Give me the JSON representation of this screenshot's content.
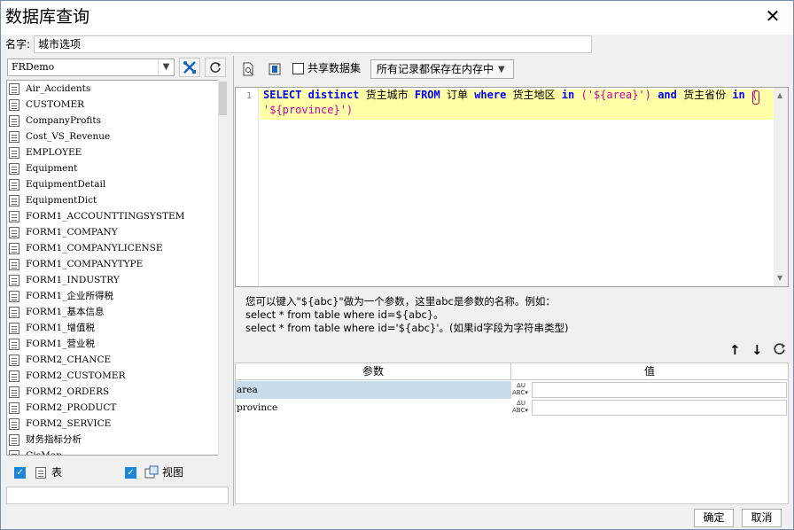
{
  "window": {
    "title": "数据库查询"
  },
  "name": {
    "label": "名字:",
    "value": "城市选项"
  },
  "datasource": {
    "selected": "FRDemo"
  },
  "tables": [
    "Air_Accidents",
    "CUSTOMER",
    "CompanyProfits",
    "Cost_VS_Revenue",
    "EMPLOYEE",
    "Equipment",
    "EquipmentDetail",
    "EquipmentDict",
    "FORM1_ACCOUNTTINGSYSTEM",
    "FORM1_COMPANY",
    "FORM1_COMPANYLICENSE",
    "FORM1_COMPANYTYPE",
    "FORM1_INDUSTRY",
    "FORM1_企业所得税",
    "FORM1_基本信息",
    "FORM1_增值税",
    "FORM1_营业税",
    "FORM2_CHANCE",
    "FORM2_CUSTOMER",
    "FORM2_ORDERS",
    "FORM2_PRODUCT",
    "FORM2_SERVICE",
    "财务指标分析",
    "GisMap"
  ],
  "filters": {
    "table_label": "表",
    "view_label": "视图"
  },
  "toolbar": {
    "share_label": "共享数据集",
    "storage_option": "所有记录都保存在内存中"
  },
  "editor": {
    "line_number": "1",
    "line1": [
      {
        "t": "SELECT",
        "c": "kw"
      },
      {
        "t": " ",
        "c": "sy"
      },
      {
        "t": "distinct",
        "c": "kw"
      },
      {
        "t": " 货主城市 ",
        "c": "sy"
      },
      {
        "t": "FROM",
        "c": "kw"
      },
      {
        "t": " 订单 ",
        "c": "sy"
      },
      {
        "t": "where",
        "c": "kw"
      },
      {
        "t": " 货主地区 ",
        "c": "sy"
      },
      {
        "t": "in",
        "c": "kw"
      },
      {
        "t": " (",
        "c": "str"
      },
      {
        "t": "'${area}'",
        "c": "str"
      },
      {
        "t": ")",
        "c": "str"
      },
      {
        "t": " ",
        "c": "sy"
      },
      {
        "t": "and",
        "c": "kw"
      },
      {
        "t": " 货主省份 ",
        "c": "sy"
      },
      {
        "t": "in",
        "c": "kw"
      },
      {
        "t": " (",
        "c": "str"
      }
    ],
    "line2": [
      {
        "t": "'${province}'",
        "c": "str"
      },
      {
        "t": ")",
        "c": "str"
      }
    ]
  },
  "help": {
    "line1": "您可以键入\"${abc}\"做为一个参数，这里abc是参数的名称。例如：",
    "line2": "select * from table where id=${abc}。",
    "line3": "select * from table where id='${abc}'。(如果id字段为字符串类型)"
  },
  "params": {
    "col_param": "参数",
    "col_value": "值",
    "type_icon_text": "ABC",
    "rows": [
      {
        "name": "area",
        "value": "",
        "selected": true
      },
      {
        "name": "province",
        "value": "",
        "selected": false
      }
    ]
  },
  "buttons": {
    "ok": "确定",
    "cancel": "取消"
  }
}
